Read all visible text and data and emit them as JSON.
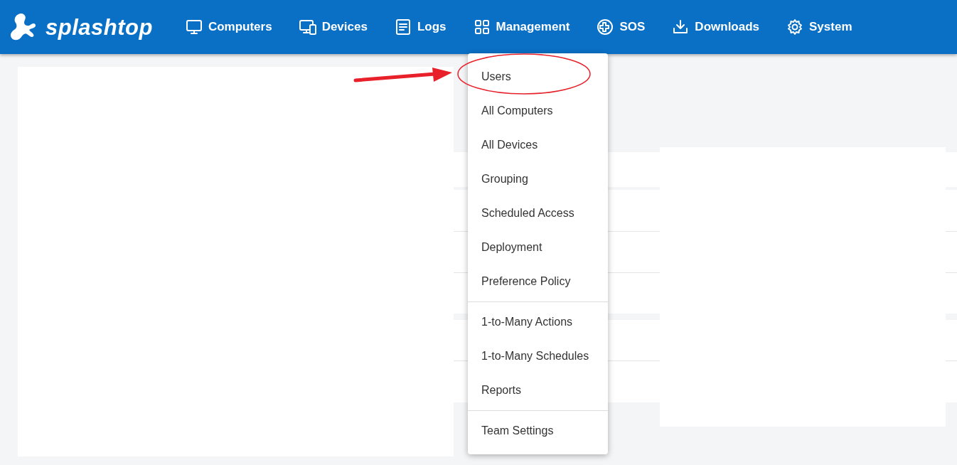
{
  "brand": {
    "name": "splashtop"
  },
  "nav": [
    {
      "label": "Computers",
      "kind": "monitor"
    },
    {
      "label": "Devices",
      "kind": "devices"
    },
    {
      "label": "Logs",
      "kind": "doc"
    },
    {
      "label": "Management",
      "kind": "grid"
    },
    {
      "label": "SOS",
      "kind": "sos"
    },
    {
      "label": "Downloads",
      "kind": "download"
    },
    {
      "label": "System",
      "kind": "gear"
    }
  ],
  "menu": {
    "groups": [
      [
        "Users",
        "All Computers",
        "All Devices",
        "Grouping",
        "Scheduled Access",
        "Deployment",
        "Preference Policy"
      ],
      [
        "1-to-Many Actions",
        "1-to-Many Schedules",
        "Reports"
      ],
      [
        "Team Settings"
      ]
    ]
  }
}
